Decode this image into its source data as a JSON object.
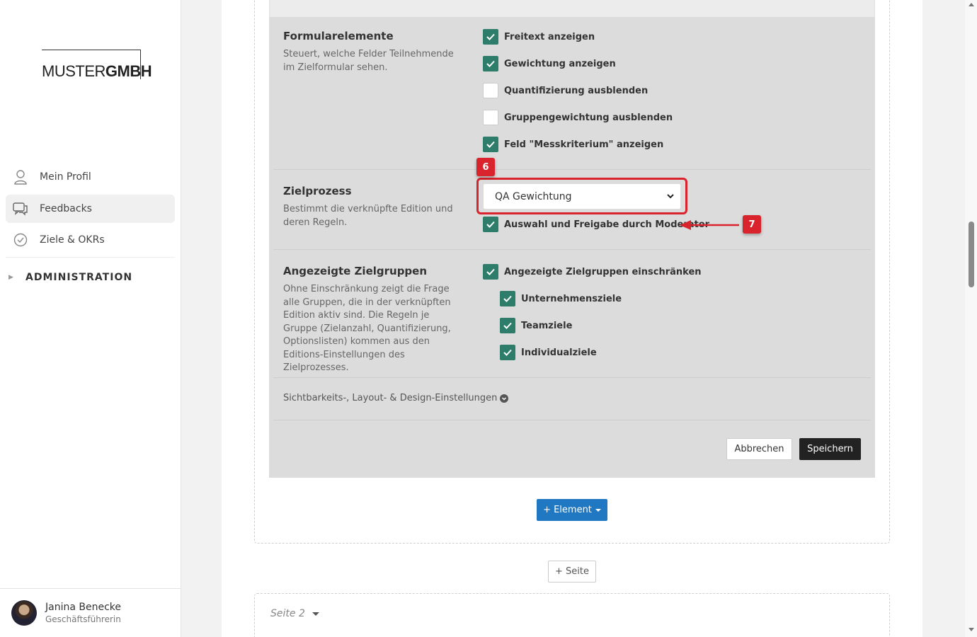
{
  "brand": {
    "logo_light": "MUSTER",
    "logo_bold": "GMBH"
  },
  "sidebar": {
    "items": [
      {
        "label": "Mein Profil",
        "icon": "user-icon"
      },
      {
        "label": "Feedbacks",
        "icon": "chat-icon"
      },
      {
        "label": "Ziele & OKRs",
        "icon": "check-circle-icon"
      }
    ],
    "admin_label": "ADMINISTRATION"
  },
  "user": {
    "name": "Janina Benecke",
    "role": "Geschäftsführerin"
  },
  "form": {
    "formularelemente": {
      "title": "Formularelemente",
      "desc": "Steuert, welche Felder Teilnehmende im Zielformular sehen.",
      "options": [
        {
          "label": "Freitext anzeigen",
          "checked": true
        },
        {
          "label": "Gewichtung anzeigen",
          "checked": true
        },
        {
          "label": "Quantifizierung ausblenden",
          "checked": false
        },
        {
          "label": "Gruppengewichtung ausblenden",
          "checked": false
        },
        {
          "label": "Feld \"Messkriterium\" anzeigen",
          "checked": true
        }
      ]
    },
    "zielprozess": {
      "title": "Zielprozess",
      "desc": "Bestimmt die verknüpfte Edition und deren Regeln.",
      "selected": "QA Gewichtung",
      "moderator_label": "Auswahl und Freigabe durch Moderator",
      "moderator_checked": true
    },
    "zielgruppen": {
      "title": "Angezeigte Zielgruppen",
      "desc": "Ohne Einschränkung zeigt die Frage alle Gruppen, die in der verknüpften Edition aktiv sind. Die Regeln je Gruppe (Zielanzahl, Quantifizierung, Optionslisten) kommen aus den Editions-Einstellungen des Zielprozesses.",
      "restrict_label": "Angezeigte Zielgruppen einschränken",
      "groups": [
        {
          "label": "Unternehmensziele",
          "checked": true
        },
        {
          "label": "Teamziele",
          "checked": true
        },
        {
          "label": "Individualziele",
          "checked": true
        }
      ]
    },
    "visibility_link": "Sichtbarkeits-, Layout- & Design-Einstellungen",
    "cancel_label": "Abbrechen",
    "save_label": "Speichern"
  },
  "annotations": {
    "badge_6": "6",
    "badge_7": "7"
  },
  "actions": {
    "add_element": "+ Element",
    "add_page": "+ Seite"
  },
  "page2": {
    "title": "Seite 2"
  },
  "colors": {
    "check": "#2e7d6b",
    "highlight": "#d9232d",
    "primary": "#1f78c1",
    "dark": "#222222"
  }
}
